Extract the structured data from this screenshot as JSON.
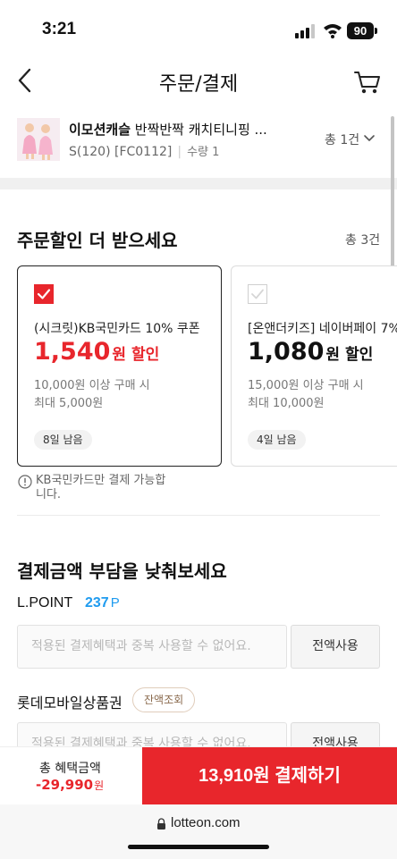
{
  "status": {
    "time": "3:21",
    "battery": "90"
  },
  "nav": {
    "title": "주문/결제"
  },
  "product": {
    "brand": "이모션캐슬",
    "name": " 반짝반짝 캐치티니핑 ...",
    "option": "S(120) [FC0112]",
    "quantity": "수량 1",
    "total": "총 1건"
  },
  "coupon_section": {
    "title": "주문할인 더 받으세요",
    "count": "총 3건",
    "cards": [
      {
        "name": "(시크릿)KB국민카드 10% 쿠폰",
        "amount": "1,540",
        "amount_unit": "원 할인",
        "cond1": "10,000원 이상 구매 시",
        "cond2": "최대 5,000원",
        "badge": "8일 남음",
        "selected": true
      },
      {
        "name": "[온앤더키즈] 네이버페이 7%",
        "amount": "1,080",
        "amount_unit": "원 할인",
        "cond1": "15,000원 이상 구매 시",
        "cond2": "최대 10,000원",
        "badge": "4일 남음",
        "selected": false
      }
    ],
    "note": "KB국민카드만 결제 가능합니다."
  },
  "payment_section": {
    "title": "결제금액 부담을 낮춰보세요",
    "lpoint": {
      "label": "L.POINT",
      "value": "237",
      "unit": "P"
    },
    "lpoint_input_placeholder": "적용된 결제혜택과 중복 사용할 수 없어요.",
    "use_all_label": "전액사용",
    "gift_label": "롯데모바일상품권",
    "balance_check_label": "잔액조회",
    "gift_input_placeholder": "적용된 결제혜택과 중복 사용할 수 없어요.",
    "gift_use_all_label": "전액사용"
  },
  "bottom": {
    "benefit_label": "총 혜택금액",
    "benefit_value": "-29,990",
    "benefit_unit": "원",
    "pay_label": "13,910원 결제하기"
  },
  "browser": {
    "url": "lotteon.com"
  },
  "colors": {
    "accent": "#e8262c",
    "point_blue": "#1f9bef"
  }
}
